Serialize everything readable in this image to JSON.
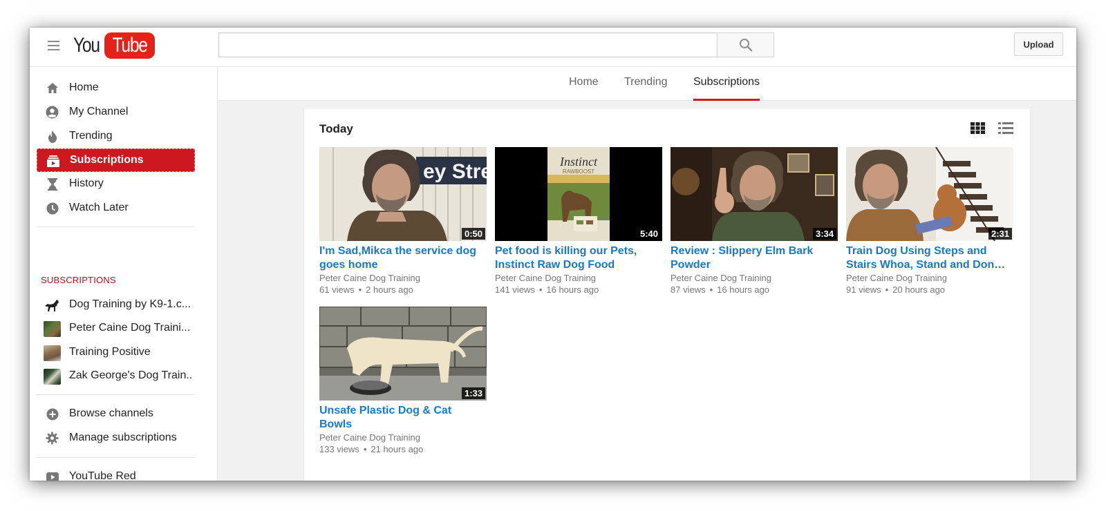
{
  "masthead": {
    "logo_you": "You",
    "logo_tube": "Tube",
    "search_placeholder": "",
    "upload_label": "Upload",
    "brand_red": "#e62117"
  },
  "guide": {
    "main_items": [
      {
        "label": "Home",
        "icon": "home-icon"
      },
      {
        "label": "My Channel",
        "icon": "account-icon"
      },
      {
        "label": "Trending",
        "icon": "flame-icon"
      },
      {
        "label": "Subscriptions",
        "icon": "subscriptions-icon",
        "active": true
      },
      {
        "label": "History",
        "icon": "hourglass-icon"
      },
      {
        "label": "Watch Later",
        "icon": "clock-icon"
      }
    ],
    "subscriptions_heading": "SUBSCRIPTIONS",
    "subscriptions": [
      {
        "label": "Dog Training by K9-1.c..."
      },
      {
        "label": "Peter Caine Dog Traini..."
      },
      {
        "label": "Training Positive"
      },
      {
        "label": "Zak George's Dog Train.."
      }
    ],
    "bottom_items": [
      {
        "label": "Browse channels",
        "icon": "plus-circle-icon"
      },
      {
        "label": "Manage subscriptions",
        "icon": "gear-icon"
      }
    ],
    "extra_items": [
      {
        "label": "YouTube Red",
        "icon": "play-icon"
      }
    ],
    "active_color": "#cc181e"
  },
  "tabs": [
    {
      "label": "Home"
    },
    {
      "label": "Trending"
    },
    {
      "label": "Subscriptions",
      "active": true
    }
  ],
  "shelf": {
    "title": "Today",
    "videos": [
      {
        "title": "I'm Sad,Mikca the service dog goes home",
        "channel": "Peter Caine Dog Training",
        "views": "61 views",
        "age": "2 hours ago",
        "duration": "0:50"
      },
      {
        "title": "Pet food is killing our Pets, Instinct Raw Dog Food",
        "channel": "Peter Caine Dog Training",
        "views": "141 views",
        "age": "16 hours ago",
        "duration": "5:40"
      },
      {
        "title": "Review : Slippery Elm Bark Powder",
        "channel": "Peter Caine Dog Training",
        "views": "87 views",
        "age": "16 hours ago",
        "duration": "3:34"
      },
      {
        "title": "Train Dog Using Steps and Stairs Whoa, Stand and Don…",
        "channel": "Peter Caine Dog Training",
        "views": "91 views",
        "age": "20 hours ago",
        "duration": "2:31"
      },
      {
        "title": "Unsafe Plastic Dog & Cat Bowls",
        "channel": "Peter Caine Dog Training",
        "views": "133 views",
        "age": "21 hours ago",
        "duration": "1:33"
      }
    ],
    "thumb_text_1": "ey Stre",
    "thumb_text_2a": "Instinct",
    "thumb_text_2b": "RAWBOOST",
    "dot": "•"
  }
}
